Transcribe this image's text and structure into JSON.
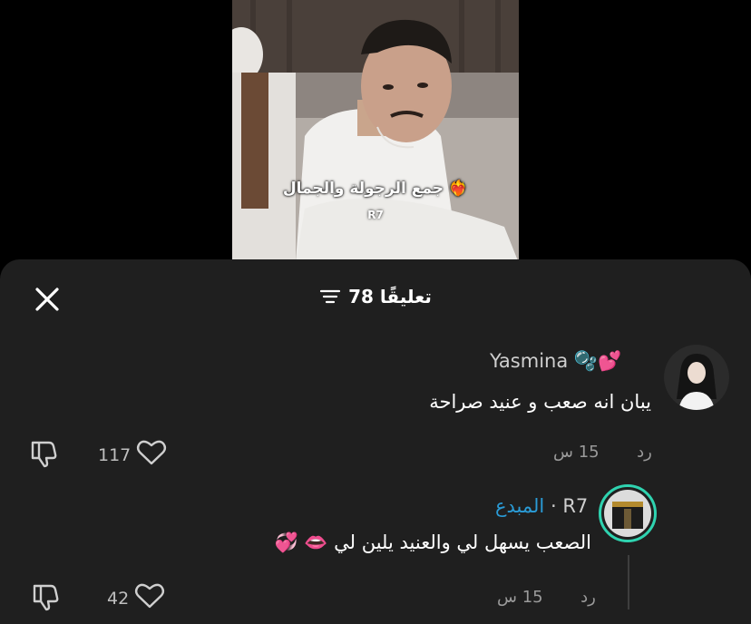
{
  "video": {
    "caption": "جمع الرجولة والجمال ❤️‍🔥",
    "watermark": "R7"
  },
  "sheet": {
    "comment_count_label": "78 تعليقًا"
  },
  "comments": [
    {
      "username": "Yasmina 🫧💕",
      "text": "يبان انه صعب و عنيد صراحة",
      "time": "15 س",
      "reply_label": "رد",
      "likes": "117"
    },
    {
      "username": "R7",
      "separator": "·",
      "creator_label": "المبدع",
      "text": "الصعب يسهل لي والعنيد يلين لي 👄 💞",
      "time": "15 س",
      "reply_label": "رد",
      "likes": "42"
    }
  ],
  "colors": {
    "sheet_bg": "#1f1f1f",
    "creator_accent": "#2a9bd6",
    "avatar_ring": "#2fd3b0"
  },
  "icons": [
    "close-icon",
    "filter-icon",
    "heart-icon",
    "dislike-icon"
  ]
}
